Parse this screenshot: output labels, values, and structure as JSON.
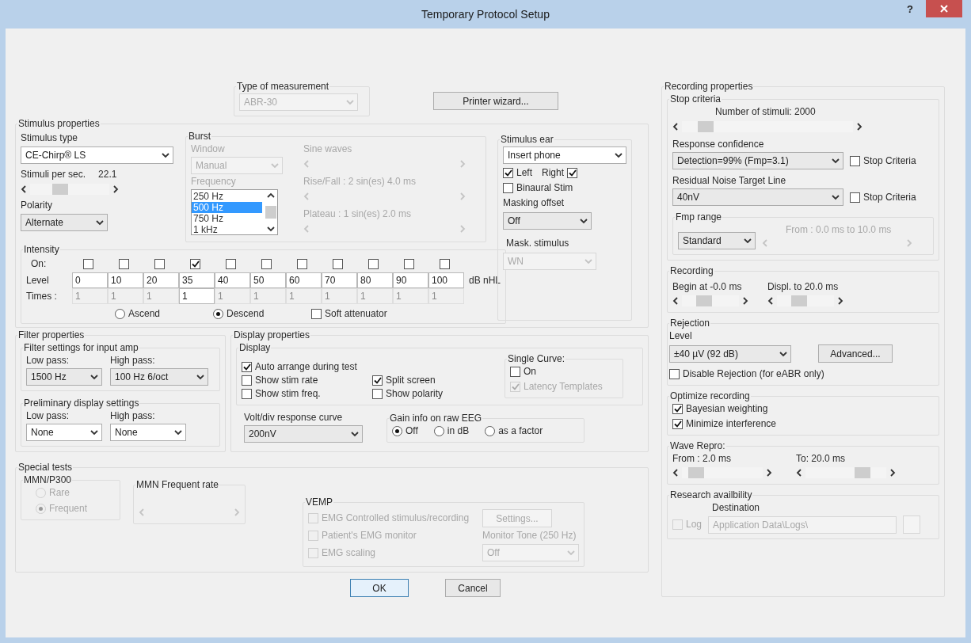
{
  "window": {
    "title": "Temporary Protocol Setup",
    "help": "?"
  },
  "measurement": {
    "title": "Type of measurement",
    "value": "ABR-30",
    "disabled": true
  },
  "printer_button": "Printer wizard...",
  "stimulus": {
    "title": "Stimulus properties",
    "type": {
      "label": "Stimulus type",
      "value": "CE-Chirp® LS"
    },
    "rate": {
      "label": "Stimuli per sec.",
      "value": "22.1",
      "level": 0.35
    },
    "polarity": {
      "label": "Polarity",
      "value": "Alternate"
    },
    "burst": {
      "title": "Burst",
      "window_label": "Window",
      "window": "Manual",
      "disabled": true,
      "frequency_label": "Frequency",
      "frequencies": [
        {
          "text": "250 Hz",
          "selected": false
        },
        {
          "text": "500 Hz",
          "selected": true
        },
        {
          "text": "750 Hz",
          "selected": false
        },
        {
          "text": "1 kHz",
          "selected": false
        }
      ],
      "sliders": [
        {
          "label": "Sine waves"
        },
        {
          "label": "Rise/Fall : 2 sin(es) 4.0 ms"
        },
        {
          "label": "Plateau : 1 sin(es) 2.0 ms"
        }
      ]
    },
    "intensity": {
      "title": "Intensity",
      "on_label": "On:",
      "db_label": "Level",
      "times_label": "Times :",
      "unit": "dB nHL",
      "steps": [
        {
          "on": false,
          "db": "0",
          "times": "1"
        },
        {
          "on": false,
          "db": "10",
          "times": "1"
        },
        {
          "on": false,
          "db": "20",
          "times": "1"
        },
        {
          "on": true,
          "db": "35",
          "times": "1"
        },
        {
          "on": false,
          "db": "40",
          "times": "1"
        },
        {
          "on": false,
          "db": "50",
          "times": "1"
        },
        {
          "on": false,
          "db": "60",
          "times": "1"
        },
        {
          "on": false,
          "db": "70",
          "times": "1"
        },
        {
          "on": false,
          "db": "80",
          "times": "1"
        },
        {
          "on": false,
          "db": "90",
          "times": "1"
        },
        {
          "on": false,
          "db": "100",
          "times": "1"
        }
      ],
      "order": [
        {
          "text": "Ascend",
          "selected": false
        },
        {
          "text": "Descend",
          "selected": true
        }
      ],
      "soft": {
        "label": "Soft attenuator",
        "checked": false
      }
    },
    "ear": {
      "title": "Stimulus ear",
      "transducer": "Insert phone",
      "left": {
        "label": "Left",
        "checked": true
      },
      "right": {
        "label": "Right",
        "checked": true
      },
      "binaural": {
        "label": "Binaural Stim",
        "checked": false
      },
      "masking_label": "Masking offset",
      "masking": "Off",
      "mask_stim_label": "Mask. stimulus",
      "mask_stim": {
        "value": "WN",
        "disabled": true
      }
    }
  },
  "filter": {
    "title": "Filter properties",
    "input": {
      "title": "Filter settings for input amp",
      "low_label": "Low pass:",
      "low": "1500 Hz",
      "high_label": "High pass:",
      "high": "100 Hz 6/oct"
    },
    "prelim": {
      "title": "Preliminary display settings",
      "low_label": "Low pass:",
      "low": "None",
      "high_label": "High pass:",
      "high": "None"
    }
  },
  "display": {
    "title": "Display properties",
    "sub": "Display",
    "options": [
      {
        "label": "Auto arrange during test",
        "checked": true
      },
      {
        "label": "Show stim rate",
        "checked": false
      },
      {
        "label": "Split screen",
        "checked": true
      },
      {
        "label": "Show stim freq.",
        "checked": false
      },
      {
        "label": "Show polarity",
        "checked": false
      }
    ],
    "single": {
      "title": "Single Curve:",
      "on": {
        "label": "On",
        "checked": false
      },
      "latency": {
        "label": "Latency Templates",
        "checked": true,
        "disabled": true
      }
    },
    "volt_label": "Volt/div response curve",
    "volt": "200nV",
    "gain": {
      "title": "Gain info on raw EEG",
      "options": [
        {
          "text": "Off",
          "selected": true
        },
        {
          "text": "in dB",
          "selected": false
        },
        {
          "text": "as a factor",
          "selected": false
        }
      ]
    }
  },
  "special": {
    "title": "Special tests",
    "mmn": {
      "title": "MMN/P300",
      "disabled": true,
      "options": [
        {
          "text": "Rare",
          "selected": false
        },
        {
          "text": "Frequent",
          "selected": true
        }
      ]
    },
    "rate_title": "MMN Frequent rate"
  },
  "vemp": {
    "title": "VEMP",
    "disabled": true,
    "emg_controlled": {
      "label": "EMG Controlled stimulus/recording",
      "checked": false
    },
    "settings": "Settings...",
    "monitor": {
      "label": "Patient's EMG monitor",
      "checked": false
    },
    "tone_label": "Monitor Tone (250 Hz)",
    "scaling": {
      "label": "EMG scaling",
      "checked": false
    },
    "tone": "Off"
  },
  "recording": {
    "title": "Recording properties",
    "stop": {
      "title": "Stop criteria",
      "count_label": "Number of stimuli: 2000",
      "level": 0.1
    },
    "confidence": {
      "label": "Response confidence",
      "value": "Detection=99% (Fmp=3.1)",
      "stop": {
        "label": "Stop Criteria",
        "checked": false
      }
    },
    "noise": {
      "label": "Residual Noise Target Line",
      "value": "40nV",
      "stop": {
        "label": "Stop Criteria",
        "checked": false
      }
    },
    "fmp": {
      "title": "Fmp range",
      "value": "Standard",
      "range": "From : 0.0 ms to 10.0 ms",
      "range_disabled": true
    },
    "rec": {
      "title": "Recording",
      "begin": {
        "label": "Begin at -0.0 ms",
        "level": 0.35
      },
      "end": {
        "label": "Displ. to  20.0 ms",
        "level": 0.35
      }
    },
    "rejection": {
      "title": "Rejection",
      "level_label": "Level",
      "value": "±40 µV (92 dB)",
      "advanced": "Advanced...",
      "disable": {
        "label": "Disable Rejection (for eABR only)",
        "checked": false
      }
    },
    "optimize": {
      "title": "Optimize recording",
      "options": [
        {
          "label": "Bayesian weighting",
          "checked": true
        },
        {
          "label": "Minimize interference",
          "checked": true
        }
      ]
    },
    "repro": {
      "title": "Wave Repro:",
      "from": {
        "label": "From : 2.0 ms",
        "level": 0.1
      },
      "to": {
        "label": "To:   20.0 ms",
        "level": 0.75
      }
    },
    "research": {
      "title": "Research availbility",
      "dest_label": "Destination",
      "disabled": true,
      "log": {
        "label": "Log",
        "checked": false
      },
      "path": "Application Data\\Logs\\"
    }
  },
  "buttons": [
    {
      "text": "OK",
      "default": true
    },
    {
      "text": "Cancel",
      "default": false
    }
  ]
}
